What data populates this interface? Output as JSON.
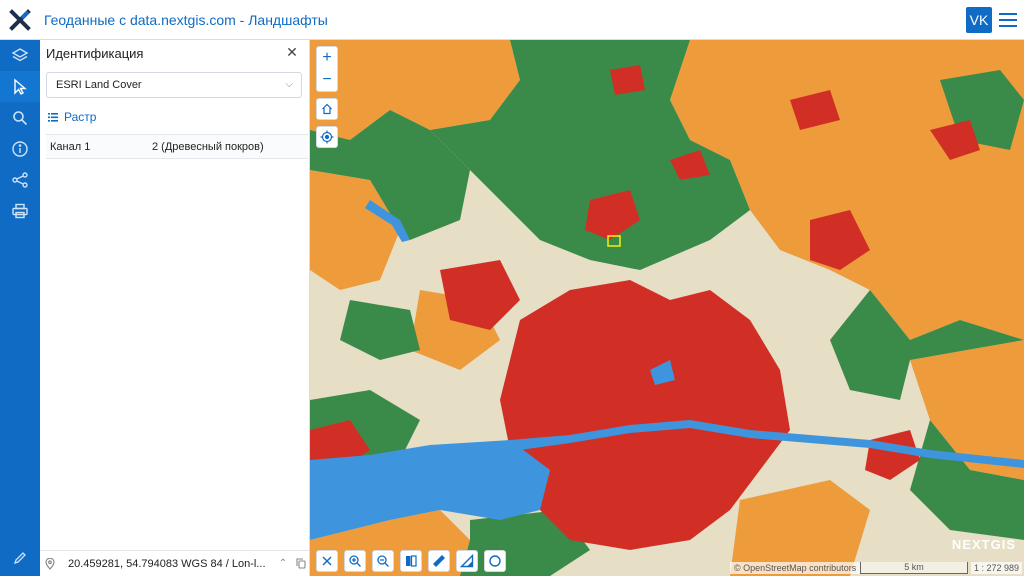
{
  "header": {
    "title": "Геоданные с data.nextgis.com - Ландшафты",
    "user_initials": "VK"
  },
  "panel": {
    "title": "Идентификация",
    "layer_select_value": "ESRI Land Cover",
    "tab_label": "Растр",
    "rows": [
      {
        "label": "Канал 1",
        "value": "2 (Древесный покров)"
      }
    ],
    "coordinates": "20.459281, 54.794083 WGS 84 / Lon-l..."
  },
  "map": {
    "brand": "NEXTGIS",
    "attribution": "© OpenStreetMap contributors",
    "scale_label": "5 km",
    "scale_ratio": "1 : 272 989"
  },
  "colors": {
    "accent": "#0f6bc4",
    "forest": "#3a8a49",
    "urban": "#d12f25",
    "crops": "#ee9b3b",
    "rangeland": "#e6dec5",
    "water": "#3f95dd"
  },
  "icons": {
    "leftbar": [
      "layers-icon",
      "select-cursor-icon",
      "search-icon",
      "info-icon",
      "share-icon",
      "print-icon"
    ],
    "bottom_tools": [
      "close-icon",
      "zoom-in-box-icon",
      "zoom-out-box-icon",
      "swipe-icon",
      "ruler-icon",
      "area-measure-icon",
      "circle-icon"
    ]
  }
}
